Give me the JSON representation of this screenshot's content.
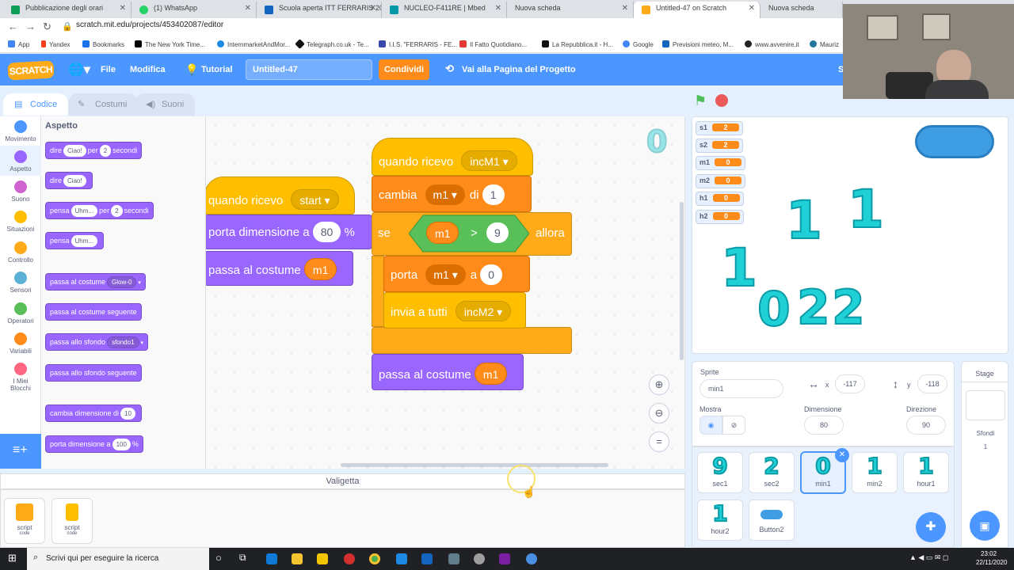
{
  "browser": {
    "tabs": [
      {
        "title": "Pubblicazione degli orari",
        "color": "#0f9d58"
      },
      {
        "title": "(1) WhatsApp",
        "color": "#25d366"
      },
      {
        "title": "Scuola aperta ITT FERRARIS 20/2",
        "color": "#1565c0"
      },
      {
        "title": "NUCLEO-F411RE | Mbed",
        "color": "#0097a7"
      },
      {
        "title": "Nuova scheda",
        "color": "#dee1e6"
      },
      {
        "title": "Untitled-47 on Scratch",
        "color": "#ffab19"
      },
      {
        "title": "Nuova scheda",
        "color": "#dee1e6"
      }
    ],
    "url": "scratch.mit.edu/projects/453402087/editor",
    "bookmarks": [
      "App",
      "Yandex",
      "Bookmarks",
      "The New York Time...",
      "InternmarketAndMor...",
      "Telegraph.co.uk - Te...",
      "I.I.S. \"FERRARIS - FE...",
      "Il Fatto Quotidiano...",
      "La Repubblica.it - H...",
      "Google",
      "Previsioni meteo, M...",
      "www.avvenire.it",
      "Mauriz"
    ]
  },
  "menu": {
    "logo": "SCRATCH",
    "file": "File",
    "edit": "Modifica",
    "tutorial": "Tutorial",
    "project_title": "Untitled-47",
    "share": "Condividi",
    "project_page": "Vai alla Pagina del Progetto",
    "user_initial": "S"
  },
  "editor_tabs": {
    "code": "Codice",
    "costumes": "Costumi",
    "sounds": "Suoni"
  },
  "categories": [
    {
      "label": "Movimento",
      "color": "#4c97ff"
    },
    {
      "label": "Aspetto",
      "color": "#9966ff"
    },
    {
      "label": "Suono",
      "color": "#cf63cf"
    },
    {
      "label": "Situazioni",
      "color": "#ffbf00"
    },
    {
      "label": "Controllo",
      "color": "#ffab19"
    },
    {
      "label": "Sensori",
      "color": "#5cb1d6"
    },
    {
      "label": "Operatori",
      "color": "#59c059"
    },
    {
      "label": "Variabili",
      "color": "#ff8c1a"
    },
    {
      "label": "I Miei Blocchi",
      "color": "#ff6680"
    }
  ],
  "palette": {
    "heading": "Aspetto",
    "say_for": {
      "word": "dire",
      "msg": "Ciao!",
      "for": "per",
      "secs": "2",
      "unit": "secondi"
    },
    "say": {
      "word": "dire",
      "msg": "Ciao!"
    },
    "think_for": {
      "word": "pensa",
      "msg": "Uhm...",
      "for": "per",
      "secs": "2",
      "unit": "secondi"
    },
    "think": {
      "word": "pensa",
      "msg": "Uhm..."
    },
    "switch_costume": {
      "word": "passa al costume",
      "value": "Glow-0"
    },
    "next_costume": "passa al costume seguente",
    "switch_backdrop": {
      "word": "passa allo sfondo",
      "value": "sfondo1"
    },
    "next_backdrop": "passa allo sfondo seguente",
    "change_size": {
      "word": "cambia dimensione di",
      "value": "10"
    },
    "set_size": {
      "word": "porta dimensione a",
      "value": "100",
      "unit": "%"
    }
  },
  "script1": {
    "hat": "quando ricevo",
    "hat_msg": "start",
    "set_size": "porta dimensione a",
    "size_val": "80",
    "size_unit": "%",
    "costume": "passa al costume",
    "costume_var": "m1"
  },
  "script2": {
    "hat": "quando ricevo",
    "hat_msg": "incM1",
    "change": "cambia",
    "change_var": "m1",
    "change_of": "di",
    "change_val": "1",
    "if": "se",
    "cond_var": "m1",
    "cond_op": ">",
    "cond_val": "9",
    "then": "allora",
    "set": "porta",
    "set_var": "m1",
    "set_to": "a",
    "set_val": "0",
    "broadcast": "invia a tutti",
    "broadcast_msg": "incM2",
    "costume": "passa al costume",
    "costume_var": "m1"
  },
  "code_area_costume_preview": "0",
  "backpack": {
    "title": "Valigetta",
    "items": [
      {
        "name": "script",
        "sub": "code"
      },
      {
        "name": "script",
        "sub": "code"
      }
    ]
  },
  "stage": {
    "monitors": [
      {
        "name": "s1",
        "value": "2"
      },
      {
        "name": "s2",
        "value": "2"
      },
      {
        "name": "m1",
        "value": "0"
      },
      {
        "name": "m2",
        "value": "0"
      },
      {
        "name": "h1",
        "value": "0"
      },
      {
        "name": "h2",
        "value": "0"
      }
    ],
    "digits": {
      "d1": "1",
      "d2": "1",
      "d3": "1",
      "d4": "0",
      "d5": "2",
      "d6": "2"
    }
  },
  "sprite_info": {
    "sprite_label": "Sprite",
    "sprite_name": "min1",
    "x_label": "x",
    "x": "-117",
    "y_label": "y",
    "y": "-118",
    "show_label": "Mostra",
    "size_label": "Dimensione",
    "size": "80",
    "direction_label": "Direzione",
    "direction": "90"
  },
  "sprites": [
    {
      "name": "sec1",
      "glyph": "9"
    },
    {
      "name": "sec2",
      "glyph": "2"
    },
    {
      "name": "min1",
      "glyph": "0"
    },
    {
      "name": "min2",
      "glyph": "1"
    },
    {
      "name": "hour1",
      "glyph": "1"
    },
    {
      "name": "hour2",
      "glyph": "1"
    },
    {
      "name": "Button2",
      "glyph": ""
    }
  ],
  "stage_panel": {
    "title": "Stage",
    "backdrops_label": "Sfondi",
    "backdrops_count": "1"
  },
  "taskbar": {
    "search_placeholder": "Scrivi qui per eseguire la ricerca",
    "time": "23:02",
    "date": "22/11/2020"
  }
}
